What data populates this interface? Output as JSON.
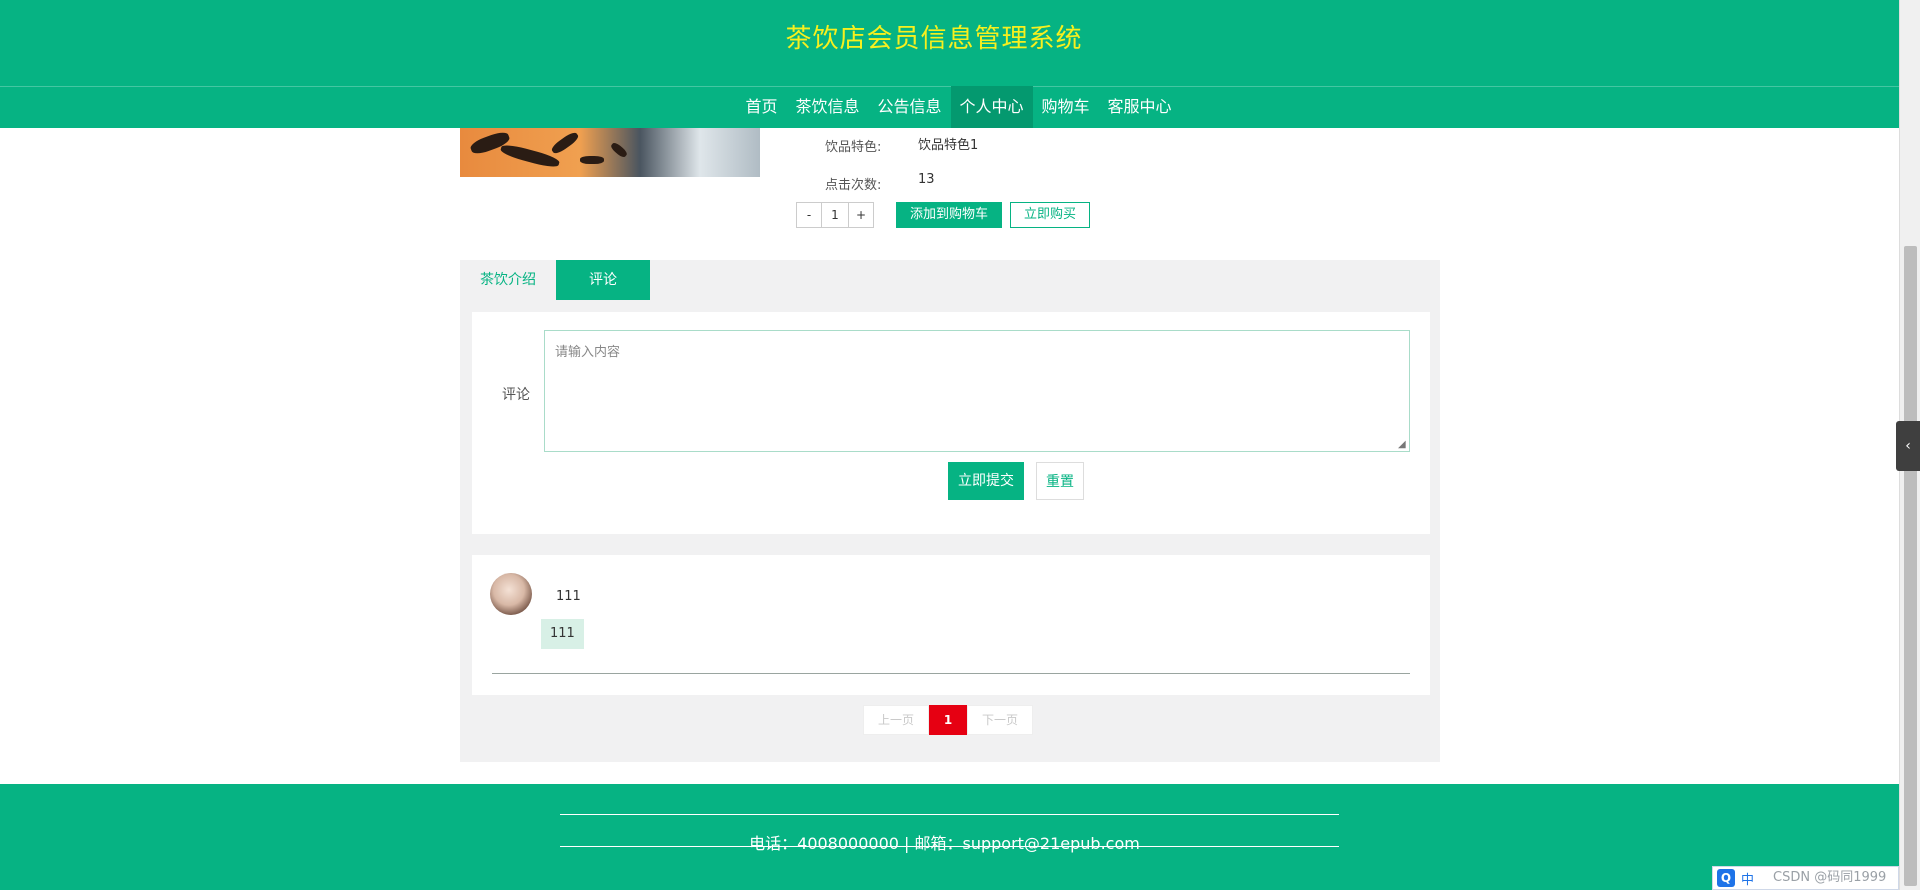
{
  "header": {
    "site_title": "茶饮店会员信息管理系统",
    "nav": [
      {
        "label": "首页",
        "active": false
      },
      {
        "label": "茶饮信息",
        "active": false
      },
      {
        "label": "公告信息",
        "active": false
      },
      {
        "label": "个人中心",
        "active": true
      },
      {
        "label": "购物车",
        "active": false
      },
      {
        "label": "客服中心",
        "active": false
      }
    ]
  },
  "product": {
    "feature_label": "饮品特色:",
    "feature_value": "饮品特色1",
    "clicks_label": "点击次数:",
    "clicks_value": "13",
    "quantity": {
      "minus": "-",
      "value": "1",
      "plus": "+"
    },
    "add_to_cart": "添加到购物车",
    "buy_now": "立即购买"
  },
  "tabs": {
    "intro": "茶饮介绍",
    "comment": "评论",
    "active": "comment"
  },
  "comment_form": {
    "label": "评论",
    "placeholder": "请输入内容",
    "value": "",
    "submit": "立即提交",
    "reset": "重置"
  },
  "comments": [
    {
      "user": "111",
      "text": "111"
    }
  ],
  "pagination": {
    "prev": "上一页",
    "current": "1",
    "next": "下一页"
  },
  "footer": {
    "contact": "电话：4008000000 | 邮箱：support@21epub.com"
  },
  "tray": {
    "q_icon": "Q",
    "ime": "中",
    "watermark": "CSDN @码同1999"
  },
  "colors": {
    "brand": "#06b383",
    "title": "#f7f01e",
    "page_current": "#e60012"
  }
}
